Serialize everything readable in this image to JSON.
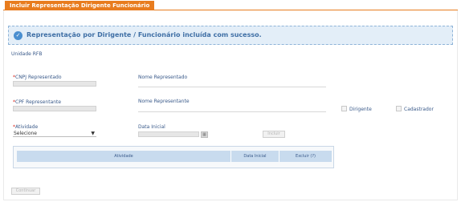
{
  "tab": {
    "title": "Incluir Representação Dirigente Funcionário"
  },
  "alert": {
    "message": "Representação por Dirigente / Funcionário incluída com sucesso."
  },
  "form": {
    "unidade_label": "Unidade RFB",
    "required_mark": "*",
    "cnpj_label": "CNPJ Representado",
    "nome_representado_label": "Nome Representado",
    "cpf_label": "CPF Representante",
    "nome_representante_label": "Nome Representante",
    "dirigente_label": "Dirigente",
    "cadastrador_label": "Cadastrador",
    "atividade_label": "Atividade",
    "atividade_value": "Selecione",
    "data_inicial_label": "Data Inicial",
    "incluir_label": "Incluir",
    "continuar_label": "Continuar"
  },
  "table": {
    "columns": [
      "Atividade",
      "Data Inicial",
      "Excluir (?)"
    ]
  }
}
